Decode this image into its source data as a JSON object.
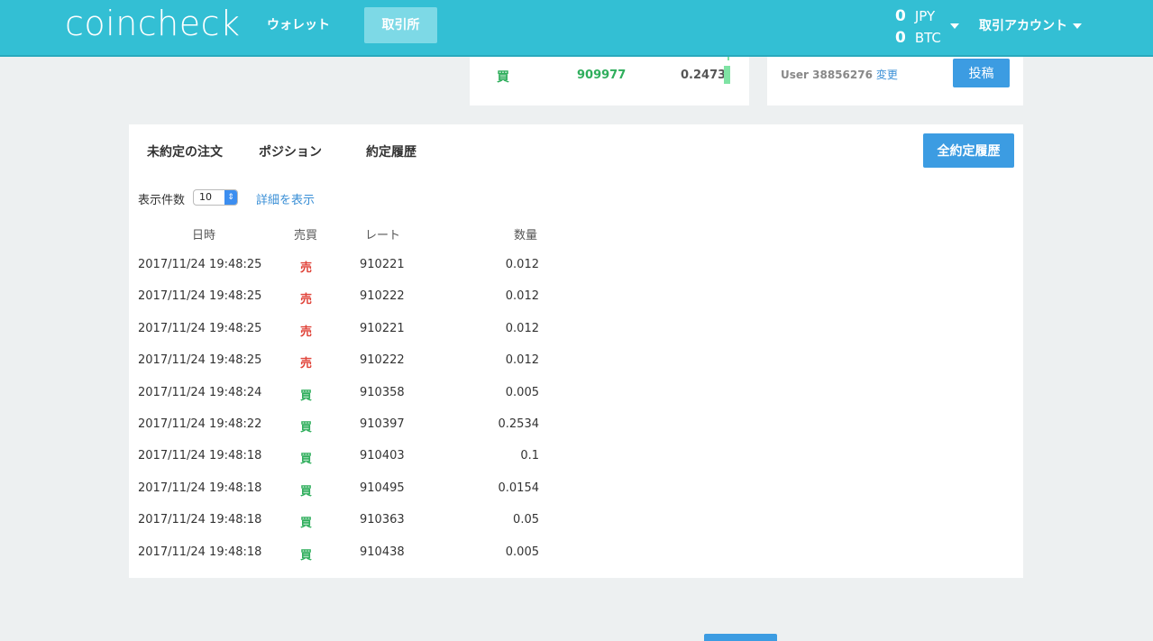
{
  "header": {
    "logo": "coincheck",
    "nav": {
      "wallet": "ウォレット",
      "exchange": "取引所"
    },
    "balances": [
      {
        "amount": "0",
        "currency": "JPY"
      },
      {
        "amount": "0",
        "currency": "BTC"
      }
    ],
    "account_label": "取引アカウント"
  },
  "top_order_row": {
    "side": "買",
    "rate": "909977",
    "amount": "0.2473"
  },
  "chat": {
    "user": "User 38856276",
    "change": "変更",
    "post_button": "投稿"
  },
  "main": {
    "tabs": {
      "open_orders": "未約定の注文",
      "positions": "ポジション",
      "history": "約定履歴"
    },
    "all_history_button": "全約定履歴",
    "count_label": "表示件数",
    "count_value": "10",
    "detail_link": "詳細を表示",
    "columns": {
      "date": "日時",
      "side": "売買",
      "rate": "レート",
      "amount": "数量"
    },
    "rows": [
      {
        "date": "2017/11/24 19:48:25",
        "side": "売",
        "rate": "910221",
        "amount": "0.012"
      },
      {
        "date": "2017/11/24 19:48:25",
        "side": "売",
        "rate": "910222",
        "amount": "0.012"
      },
      {
        "date": "2017/11/24 19:48:25",
        "side": "売",
        "rate": "910221",
        "amount": "0.012"
      },
      {
        "date": "2017/11/24 19:48:25",
        "side": "売",
        "rate": "910222",
        "amount": "0.012"
      },
      {
        "date": "2017/11/24 19:48:24",
        "side": "買",
        "rate": "910358",
        "amount": "0.005"
      },
      {
        "date": "2017/11/24 19:48:22",
        "side": "買",
        "rate": "910397",
        "amount": "0.2534"
      },
      {
        "date": "2017/11/24 19:48:18",
        "side": "買",
        "rate": "910403",
        "amount": "0.1"
      },
      {
        "date": "2017/11/24 19:48:18",
        "side": "買",
        "rate": "910495",
        "amount": "0.0154"
      },
      {
        "date": "2017/11/24 19:48:18",
        "side": "買",
        "rate": "910363",
        "amount": "0.05"
      },
      {
        "date": "2017/11/24 19:48:18",
        "side": "買",
        "rate": "910438",
        "amount": "0.005"
      }
    ]
  },
  "colors": {
    "header": "#33bfd4",
    "buy": "#2fae5c",
    "sell": "#e0443a",
    "button": "#3c9ce2"
  }
}
